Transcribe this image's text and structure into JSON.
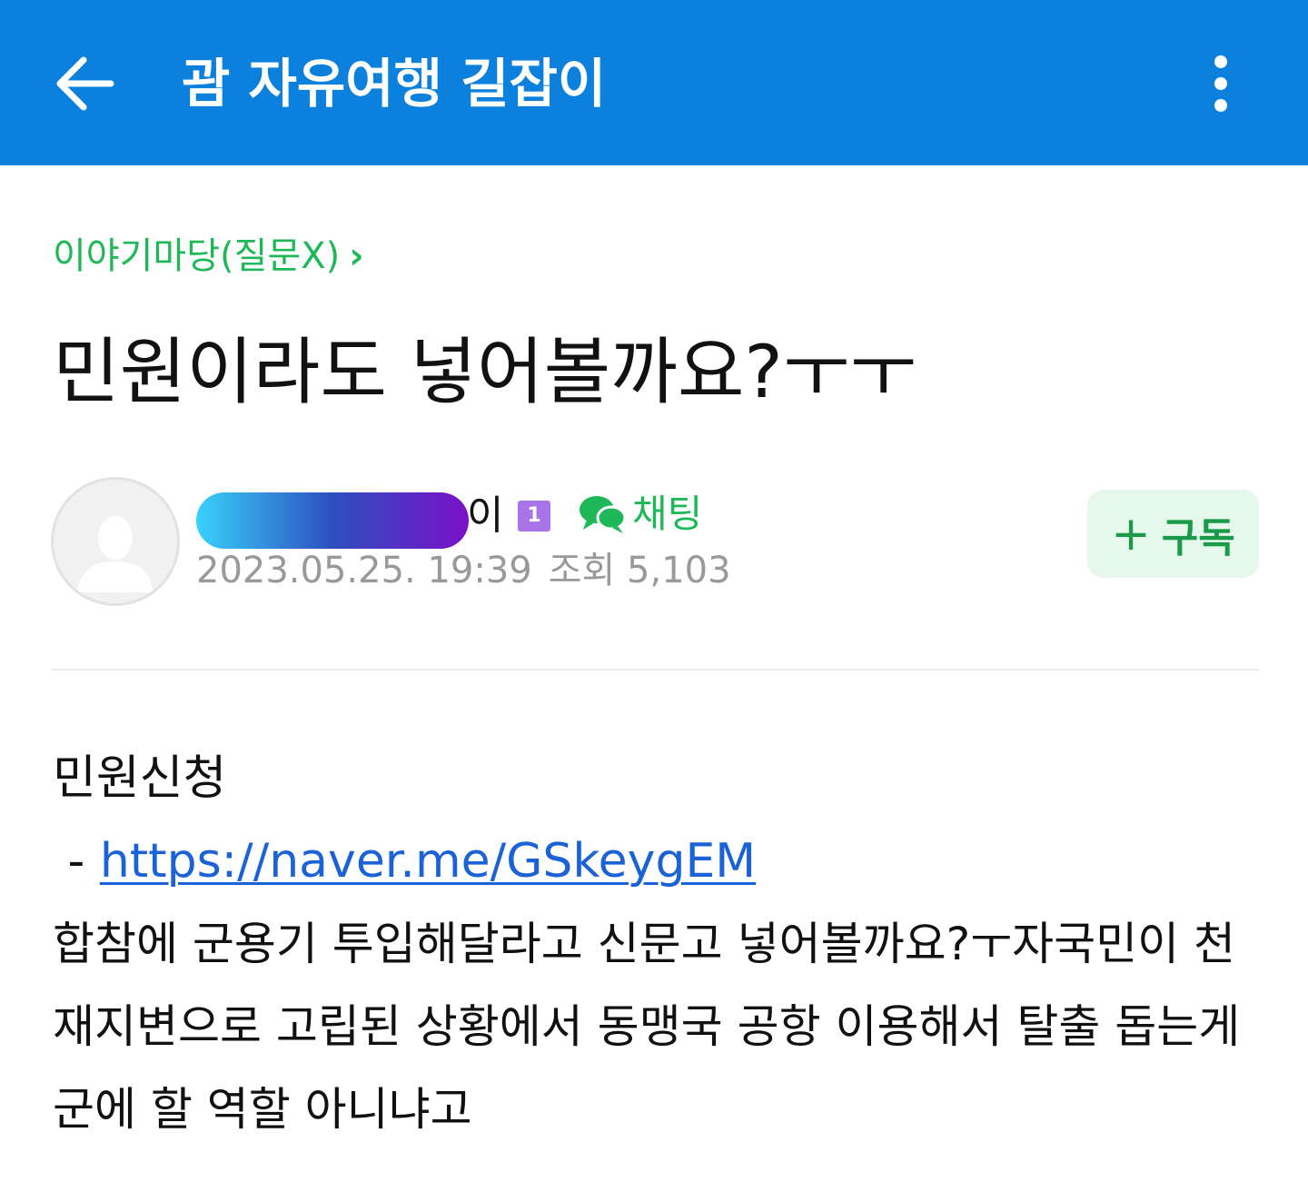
{
  "app_bar": {
    "title": "괌 자유여행 길잡이",
    "background": "#0b80dc"
  },
  "breadcrumb": {
    "board": "이야기마당(질문X)",
    "chevron": "›"
  },
  "post": {
    "title": "민원이라도 넣어볼까요?ㅜㅜ",
    "author_suffix": "이",
    "level": "1",
    "chat_label": "채팅",
    "date": "2023.05.25. 19:39",
    "views": "조회 5,103",
    "subscribe_plus": "+",
    "subscribe_label": "구독",
    "body": {
      "heading": "민원신청",
      "link_prefix": " - ",
      "link": "https://naver.me/GSkeygEM",
      "text": "합참에 군용기 투입해달라고 신문고 넣어볼까요?ㅜ자국민이 천재지변으로 고립된 상황에서 동맹국 공항 이용해서 탈출 돕는게 군에 할 역할 아니냐고"
    }
  },
  "colors": {
    "accent_green": "#1fb858",
    "link_blue": "#1a62d6",
    "meta_gray": "#999999"
  },
  "icons": [
    "back-arrow-icon",
    "more-vertical-icon",
    "default-profile-icon",
    "chat-bubbles-icon"
  ]
}
